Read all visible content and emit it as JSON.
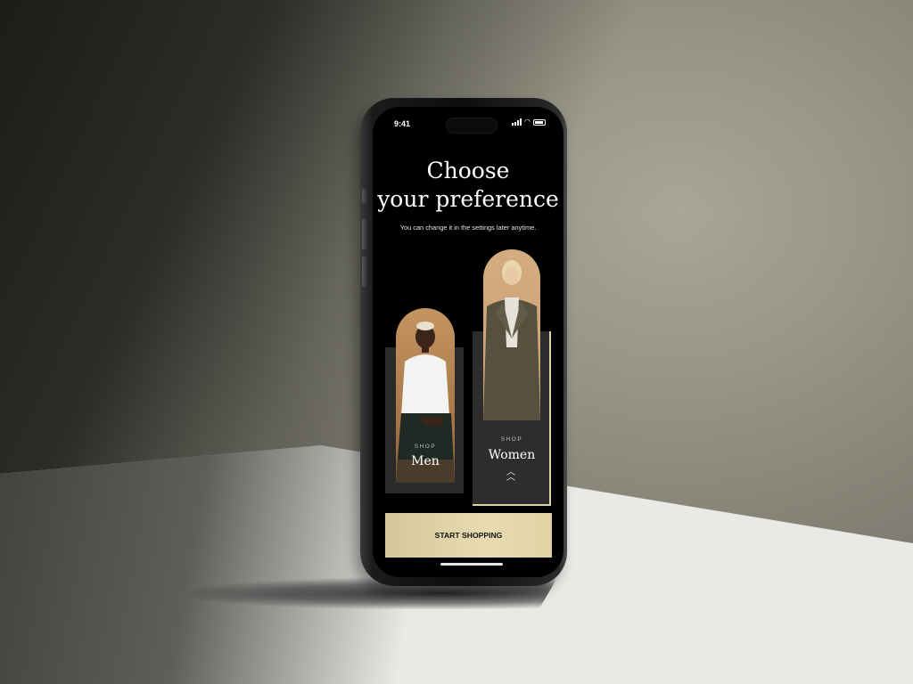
{
  "status_bar": {
    "time": "9:41"
  },
  "onboarding": {
    "title_line1": "Choose",
    "title_line2": "your preference",
    "subtitle": "You can change it in the settings later anytime."
  },
  "options": [
    {
      "shop_label": "SHOP",
      "name": "Men",
      "selected": false
    },
    {
      "shop_label": "SHOP",
      "name": "Women",
      "selected": true
    }
  ],
  "cta": {
    "label": "START SHOPPING"
  },
  "colors": {
    "accent_gold": "#e3d3a4",
    "screen_bg": "#000000",
    "card_bg": "#2a2a2a"
  }
}
